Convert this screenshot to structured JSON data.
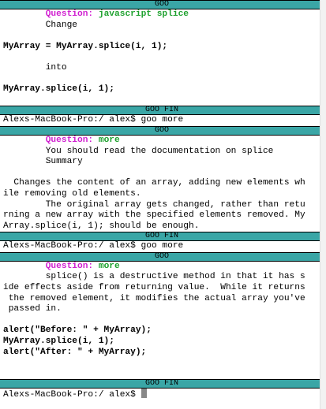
{
  "lines": [
    {
      "type": "bar",
      "text": "GOO"
    },
    {
      "type": "question",
      "label": "Question:",
      "text": "javascript splice"
    },
    {
      "type": "text",
      "text": "        Change"
    },
    {
      "type": "blank"
    },
    {
      "type": "code",
      "text": "MyArray = MyArray.splice(i, 1);"
    },
    {
      "type": "blank"
    },
    {
      "type": "text",
      "text": "        into"
    },
    {
      "type": "blank"
    },
    {
      "type": "code",
      "text": "MyArray.splice(i, 1);"
    },
    {
      "type": "blank"
    },
    {
      "type": "bar",
      "text": "GOO FIN"
    },
    {
      "type": "text",
      "text": "Alexs-MacBook-Pro:/ alex$ goo more"
    },
    {
      "type": "bar",
      "text": "GOO"
    },
    {
      "type": "question",
      "label": "Question:",
      "text": "more"
    },
    {
      "type": "text",
      "text": "        You should read the documentation on splice"
    },
    {
      "type": "text",
      "text": "        Summary"
    },
    {
      "type": "blank"
    },
    {
      "type": "text",
      "text": "  Changes the content of an array, adding new elements wh"
    },
    {
      "type": "text",
      "text": "ile removing old elements."
    },
    {
      "type": "text",
      "text": "        The original array gets changed, rather than retu"
    },
    {
      "type": "text",
      "text": "rning a new array with the specified elements removed. My"
    },
    {
      "type": "text",
      "text": "Array.splice(i, 1); should be enough."
    },
    {
      "type": "bar",
      "text": "GOO FIN"
    },
    {
      "type": "text",
      "text": "Alexs-MacBook-Pro:/ alex$ goo more"
    },
    {
      "type": "bar",
      "text": "GOO"
    },
    {
      "type": "question",
      "label": "Question:",
      "text": "more"
    },
    {
      "type": "text",
      "text": "        splice() is a destructive method in that it has s"
    },
    {
      "type": "text",
      "text": "ide effects aside from returning value.  While it returns"
    },
    {
      "type": "text",
      "text": " the removed element, it modifies the actual array you've"
    },
    {
      "type": "text",
      "text": " passed in."
    },
    {
      "type": "blank"
    },
    {
      "type": "code",
      "text": "alert(\"Before: \" + MyArray);"
    },
    {
      "type": "code",
      "text": "MyArray.splice(i, 1);"
    },
    {
      "type": "code",
      "text": "alert(\"After: \" + MyArray);"
    },
    {
      "type": "blank"
    },
    {
      "type": "blank"
    },
    {
      "type": "bar",
      "text": "GOO FIN"
    },
    {
      "type": "prompt",
      "text": "Alexs-MacBook-Pro:/ alex$ "
    }
  ],
  "colors": {
    "bar": "#3aa6a6",
    "question_label": "#d01fd0",
    "question_text": "#1fa12f",
    "cursor": "#888888"
  }
}
